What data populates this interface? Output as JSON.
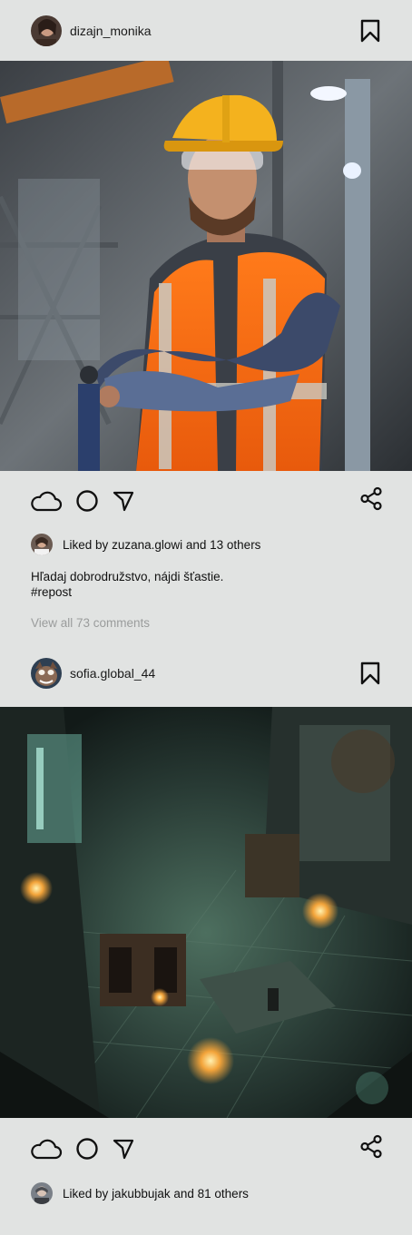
{
  "posts": [
    {
      "username": "dizajn_monika",
      "liked_by_prefix": "Liked by",
      "liked_user": "zuzana.glowi",
      "liked_suffix": "and 13 others",
      "caption_line1": "Hľadaj dobrodružstvo, nájdi šťastie.",
      "caption_line2": "#repost",
      "view_comments": "View all 73 comments",
      "photo_desc": "construction-worker-photo"
    },
    {
      "username": "sofia.global_44",
      "liked_by_prefix": "Liked by",
      "liked_user": "jakubbujak",
      "liked_suffix": "and 81 others",
      "photo_desc": "fantasy-dungeon-photo"
    }
  ],
  "icons": {
    "like": "cloud-icon",
    "comment": "circle-icon",
    "send": "send-icon",
    "share": "share-icon",
    "save": "bookmark-icon"
  },
  "colors": {
    "background": "#e1e3e2",
    "muted_text": "#9a9c9c"
  }
}
